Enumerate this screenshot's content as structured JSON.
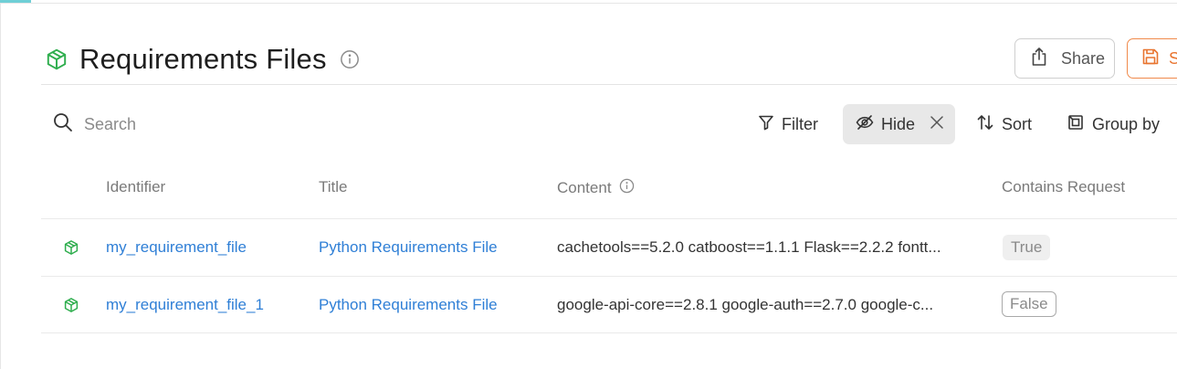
{
  "page": {
    "title": "Requirements Files"
  },
  "actions": {
    "share_label": "Share",
    "save_label": "S"
  },
  "toolbar": {
    "search_placeholder": "Search",
    "filter_label": "Filter",
    "hide_label": "Hide",
    "sort_label": "Sort",
    "group_label": "Group by"
  },
  "table": {
    "columns": [
      "Identifier",
      "Title",
      "Content",
      "Contains Request"
    ],
    "rows": [
      {
        "identifier": "my_requirement_file",
        "title": "Python Requirements File",
        "content": "cachetools==5.2.0 catboost==1.1.1 Flask==2.2.2 fontt...",
        "contains_request": "True"
      },
      {
        "identifier": "my_requirement_file_1",
        "title": "Python Requirements File",
        "content": "google-api-core==2.8.1 google-auth==2.7.0 google-c...",
        "contains_request": "False"
      }
    ]
  },
  "colors": {
    "accent_green": "#2fae4e",
    "link_blue": "#2f7fd6",
    "save_orange": "#f08a4b"
  },
  "icons": [
    "cube-icon",
    "info-icon",
    "share-icon",
    "save-icon",
    "search-icon",
    "filter-icon",
    "eye-off-icon",
    "close-icon",
    "sort-icon",
    "group-icon"
  ]
}
